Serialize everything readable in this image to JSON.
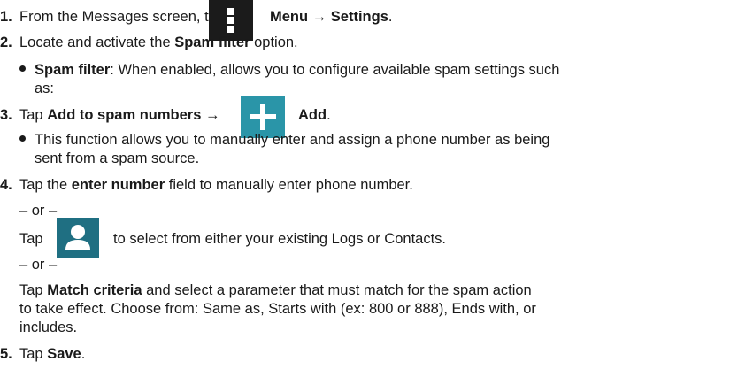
{
  "steps": {
    "s1": {
      "num": "1.",
      "pre": "From the Messages screen, tap",
      "menu": "Menu",
      "arrow": "→",
      "settings": "Settings",
      "end": "."
    },
    "s2": {
      "num": "2.",
      "pre": "Locate and activate the",
      "bold": "Spam filter",
      "post": "option."
    },
    "b1": {
      "bold": "Spam filter",
      "line1": ": When enabled, allows you to configure available spam settings such",
      "line2": "as:"
    },
    "s3": {
      "num": "3.",
      "pre": "Tap",
      "bold": "Add to spam numbers",
      "arrow": "→",
      "add": "Add",
      "end": "."
    },
    "b2": {
      "line1": "This function allows you to manually enter and assign a phone number as being",
      "line2": "sent from a spam source."
    },
    "s4": {
      "num": "4.",
      "pre": "Tap the",
      "bold": "enter number",
      "post": "field to manually enter phone number."
    },
    "or1": "– or –",
    "tap_contact": {
      "pre": "Tap",
      "post": "to select from either your existing Logs or Contacts."
    },
    "or2": "– or –",
    "match": {
      "pre": "Tap",
      "bold": "Match criteria",
      "line1": "and select a parameter that must match for the spam action",
      "line2": "to take effect. Choose from: Same as, Starts with (ex: 800 or 888), Ends with, or",
      "line3": "includes."
    },
    "s5": {
      "num": "5.",
      "pre": "Tap",
      "bold": "Save",
      "end": "."
    }
  },
  "icons": {
    "menu": "menu-icon",
    "add": "add-icon",
    "contact": "contact-icon",
    "colors": {
      "menu_bg": "#1b1b1b",
      "add_bg": "#2a95a8",
      "contact_bg": "#1f6f82"
    }
  }
}
